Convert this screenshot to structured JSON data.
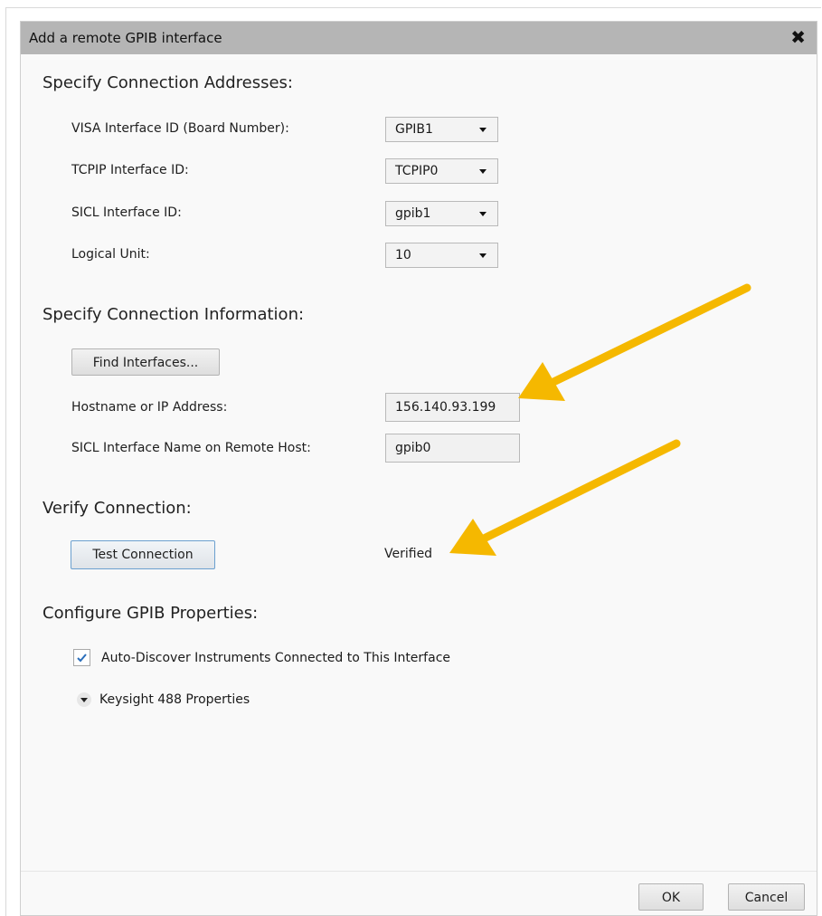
{
  "dialog": {
    "title": "Add a remote GPIB interface",
    "close_glyph": "✕"
  },
  "addresses": {
    "heading": "Specify Connection Addresses:",
    "fields": [
      {
        "label": "VISA Interface ID (Board Number):",
        "value": "GPIB1"
      },
      {
        "label": "TCPIP Interface ID:",
        "value": "TCPIP0"
      },
      {
        "label": "SICL Interface ID:",
        "value": "gpib1"
      },
      {
        "label": "Logical Unit:",
        "value": "10"
      }
    ]
  },
  "info": {
    "heading": "Specify Connection Information:",
    "find_button": "Find Interfaces...",
    "hostname_label": "Hostname or IP Address:",
    "hostname_value": "156.140.93.199",
    "sicl_name_label": "SICL Interface Name on Remote Host:",
    "sicl_name_value": "gpib0"
  },
  "verify": {
    "heading": "Verify Connection:",
    "test_button": "Test Connection",
    "status": "Verified"
  },
  "gpib": {
    "heading": "Configure GPIB Properties:",
    "auto_discover_label": "Auto-Discover Instruments Connected to This Interface",
    "auto_discover_checked": true,
    "expander_label": "Keysight 488 Properties"
  },
  "footer": {
    "ok_label": "OK",
    "cancel_label": "Cancel"
  },
  "colors": {
    "titlebar": "#b5b5b5",
    "annotation_arrow": "#f5b800",
    "checkmark": "#2a6ebb"
  }
}
